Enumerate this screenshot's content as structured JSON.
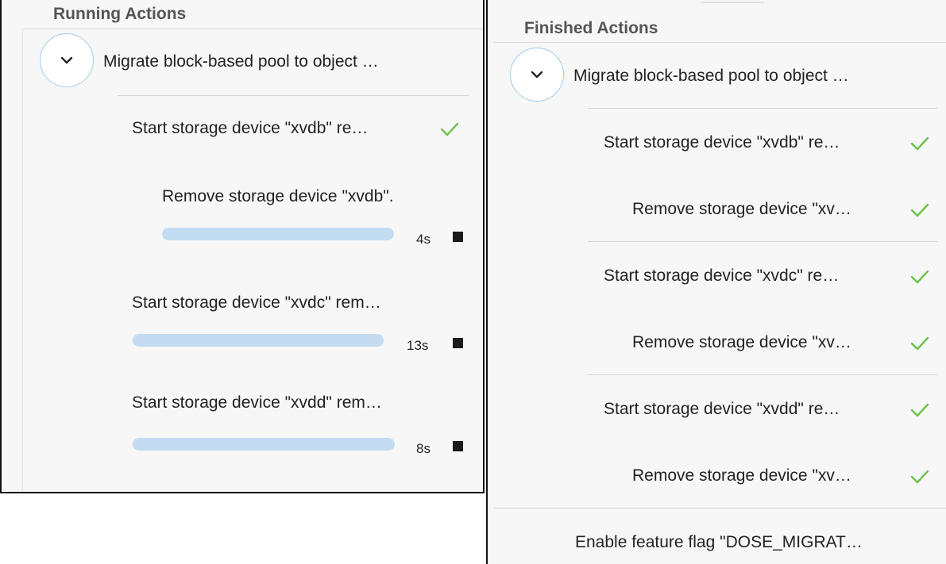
{
  "running": {
    "title": "Running Actions",
    "group_label": "Migrate block-based pool to object …",
    "actions": [
      {
        "label": "Start storage device \"xvdb\" re…",
        "status": "done"
      },
      {
        "label": "Remove storage device \"xvdb\".",
        "status": "running",
        "elapsed": "4s",
        "progress": 1.0
      },
      {
        "label": "Start storage device \"xvdc\" rem…",
        "status": "running",
        "elapsed": "13s",
        "progress": 1.0
      },
      {
        "label": "Start storage device \"xvdd\" rem…",
        "status": "running",
        "elapsed": "8s",
        "progress": 1.0
      }
    ]
  },
  "finished": {
    "title": "Finished Actions",
    "group_label": "Migrate block-based pool to object …",
    "actions": [
      {
        "label": "Start storage device \"xvdb\" re…",
        "status": "done"
      },
      {
        "label": "Remove storage device \"xv…",
        "status": "done"
      },
      {
        "label": "Start storage device \"xvdc\" re…",
        "status": "done"
      },
      {
        "label": "Remove storage device \"xv…",
        "status": "done"
      },
      {
        "label": "Start storage device \"xvdd\" re…",
        "status": "done"
      },
      {
        "label": "Remove storage device \"xv…",
        "status": "done"
      },
      {
        "label": "Enable feature flag \"DOSE_MIGRAT…",
        "status": "done"
      }
    ]
  },
  "icons": {
    "toggle": "chevron-down-icon",
    "done": "checkmark-icon",
    "stop": "stop-icon"
  },
  "colors": {
    "check": "#6cc24a",
    "progress": "#c3dcf2",
    "toggle_border": "#9fcbec",
    "stop": "#1a1a1a"
  }
}
